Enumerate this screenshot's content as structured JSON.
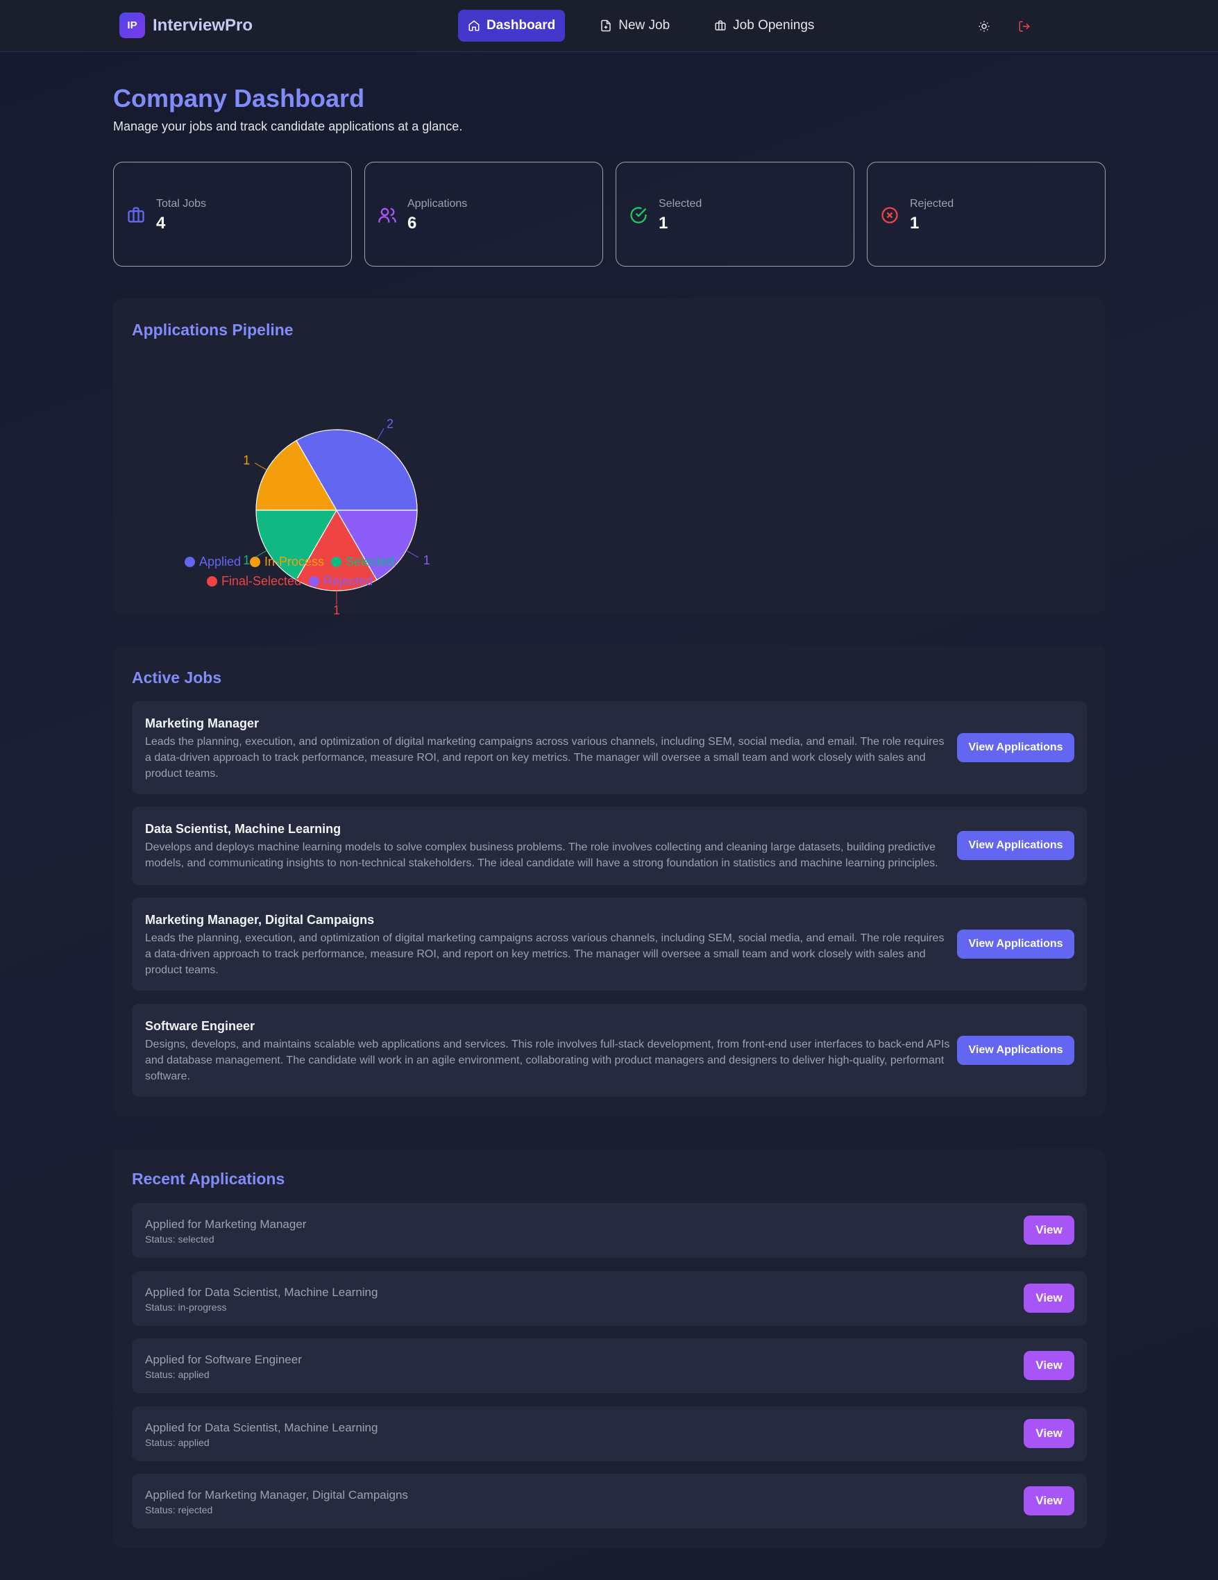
{
  "app": {
    "logo_mark": "IP",
    "name": "InterviewPro"
  },
  "nav": {
    "links": [
      {
        "label": "Dashboard",
        "icon": "home-icon"
      },
      {
        "label": "New Job",
        "icon": "file-plus-icon"
      },
      {
        "label": "Job Openings",
        "icon": "briefcase-icon"
      }
    ],
    "theme_icon": "sun-icon",
    "logout_icon": "logout-icon"
  },
  "header": {
    "title": "Company Dashboard",
    "subtitle": "Manage your jobs and track candidate applications at a glance."
  },
  "stats": [
    {
      "label": "Total Jobs",
      "value": "4",
      "icon": "briefcase-icon",
      "color": "#6366f1"
    },
    {
      "label": "Applications",
      "value": "6",
      "icon": "users-icon",
      "color": "#a855f7"
    },
    {
      "label": "Selected",
      "value": "1",
      "icon": "check-circle-icon",
      "color": "#22c55e"
    },
    {
      "label": "Rejected",
      "value": "1",
      "icon": "x-circle-icon",
      "color": "#ef4444"
    }
  ],
  "pipeline": {
    "title": "Applications Pipeline"
  },
  "chart_data": {
    "type": "pie",
    "categories": [
      "Applied",
      "In-Process",
      "Selected",
      "Final-Selected",
      "Rejected"
    ],
    "values": [
      2,
      1,
      1,
      1,
      1
    ],
    "colors": [
      "#6366f1",
      "#f59e0b",
      "#10b981",
      "#ef4444",
      "#8b5cf6"
    ],
    "legend_position": "bottom"
  },
  "active_jobs": {
    "title": "Active Jobs",
    "button_label": "View Applications",
    "items": [
      {
        "title": "Marketing Manager",
        "description": "Leads the planning, execution, and optimization of digital marketing campaigns across various channels, including SEM, social media, and email. The role requires a data-driven approach to track performance, measure ROI, and report on key metrics. The manager will oversee a small team and work closely with sales and product teams."
      },
      {
        "title": "Data Scientist, Machine Learning",
        "description": "Develops and deploys machine learning models to solve complex business problems. The role involves collecting and cleaning large datasets, building predictive models, and communicating insights to non-technical stakeholders. The ideal candidate will have a strong foundation in statistics and machine learning principles."
      },
      {
        "title": "Marketing Manager, Digital Campaigns",
        "description": "Leads the planning, execution, and optimization of digital marketing campaigns across various channels, including SEM, social media, and email. The role requires a data-driven approach to track performance, measure ROI, and report on key metrics. The manager will oversee a small team and work closely with sales and product teams."
      },
      {
        "title": "Software Engineer",
        "description": "Designs, develops, and maintains scalable web applications and services. This role involves full-stack development, from front-end user interfaces to back-end APIs and database management. The candidate will work in an agile environment, collaborating with product managers and designers to deliver high-quality, performant software."
      }
    ]
  },
  "recent_applications": {
    "title": "Recent Applications",
    "button_label": "View",
    "items": [
      {
        "title": "Applied for Marketing Manager",
        "status": "Status: selected"
      },
      {
        "title": "Applied for Data Scientist, Machine Learning",
        "status": "Status: in-progress"
      },
      {
        "title": "Applied for Software Engineer",
        "status": "Status: applied"
      },
      {
        "title": "Applied for Data Scientist, Machine Learning",
        "status": "Status: applied"
      },
      {
        "title": "Applied for Marketing Manager, Digital Campaigns",
        "status": "Status: rejected"
      }
    ]
  }
}
